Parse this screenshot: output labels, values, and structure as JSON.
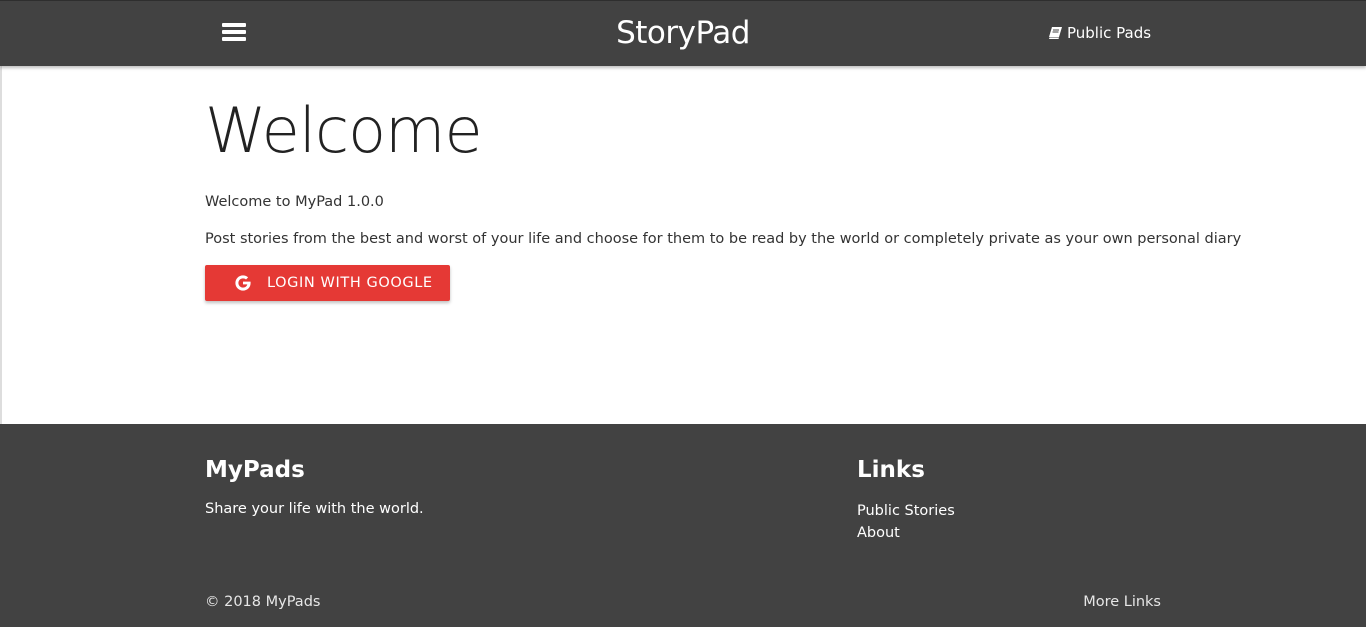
{
  "navbar": {
    "menu_icon": "hamburger-menu-icon",
    "brand": "StoryPad",
    "public_pads_icon": "book-icon",
    "public_pads_label": "Public Pads"
  },
  "main": {
    "title": "Welcome",
    "version_text": "Welcome to MyPad 1.0.0",
    "description": "Post stories from the best and worst of your life and choose for them to be read by the world or completely private as your own personal diary",
    "login_button": {
      "icon": "google-icon",
      "label": "LOGIN WITH GOOGLE"
    }
  },
  "footer": {
    "brand_title": "MyPads",
    "tagline": "Share your life with the world.",
    "links_title": "Links",
    "links": [
      "Public Stories",
      "About"
    ],
    "copyright": "© 2018 MyPads",
    "more_links": "More Links"
  },
  "colors": {
    "navbar_bg": "#424242",
    "footer_bg": "#424242",
    "login_button_bg": "#e53935",
    "page_bg": "#ffffff"
  }
}
